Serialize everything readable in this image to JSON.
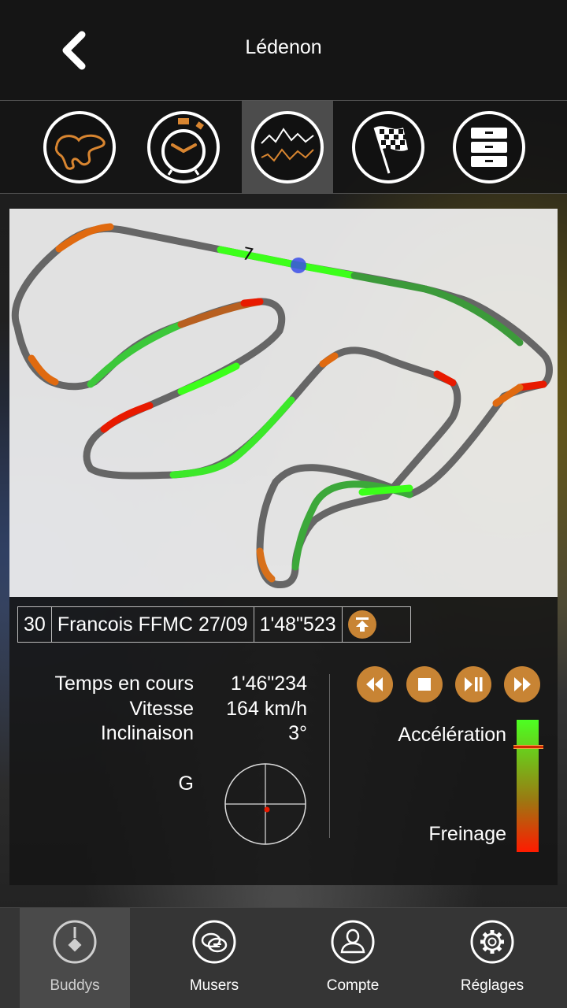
{
  "header": {
    "title": "Lédenon",
    "back_icon": "chevron-left-icon"
  },
  "toolbar": {
    "items": [
      {
        "icon": "track-map-icon",
        "active": false
      },
      {
        "icon": "stopwatch-icon",
        "active": false
      },
      {
        "icon": "graph-icon",
        "active": true
      },
      {
        "icon": "checkered-flag-icon",
        "active": false
      },
      {
        "icon": "drawers-icon",
        "active": false
      }
    ]
  },
  "track": {
    "corner_number": "7",
    "colors": {
      "neutral": "#666666",
      "accel": "#3cff1a",
      "brake": "#e81a00",
      "transition": "#e06a10",
      "position_marker": "#3a4ee8"
    }
  },
  "lap": {
    "number": "30",
    "rider": "Francois FFMC 27/09",
    "time": "1'48\"523",
    "toggle_icon": "collapse-up-icon"
  },
  "stats": {
    "current_time_label": "Temps en cours",
    "current_time_value": "1'46\"234",
    "speed_label": "Vitesse",
    "speed_value": "164 km/h",
    "lean_label": "Inclinaison",
    "lean_value": "3°",
    "g_label": "G"
  },
  "playback": {
    "buttons": [
      "rewind-icon",
      "stop-icon",
      "play-pause-icon",
      "fast-forward-icon"
    ]
  },
  "legend": {
    "accel_label": "Accélération",
    "brake_label": "Freinage",
    "accel_color": "#4cff22",
    "brake_color": "#ff1b00"
  },
  "nav": {
    "items": [
      {
        "label": "Buddys",
        "icon": "buddys-power-icon",
        "active": true
      },
      {
        "label": "Musers",
        "icon": "chat-bubbles-icon",
        "active": false
      },
      {
        "label": "Compte",
        "icon": "user-icon",
        "active": false
      },
      {
        "label": "Réglages",
        "icon": "gear-icon",
        "active": false
      }
    ]
  }
}
